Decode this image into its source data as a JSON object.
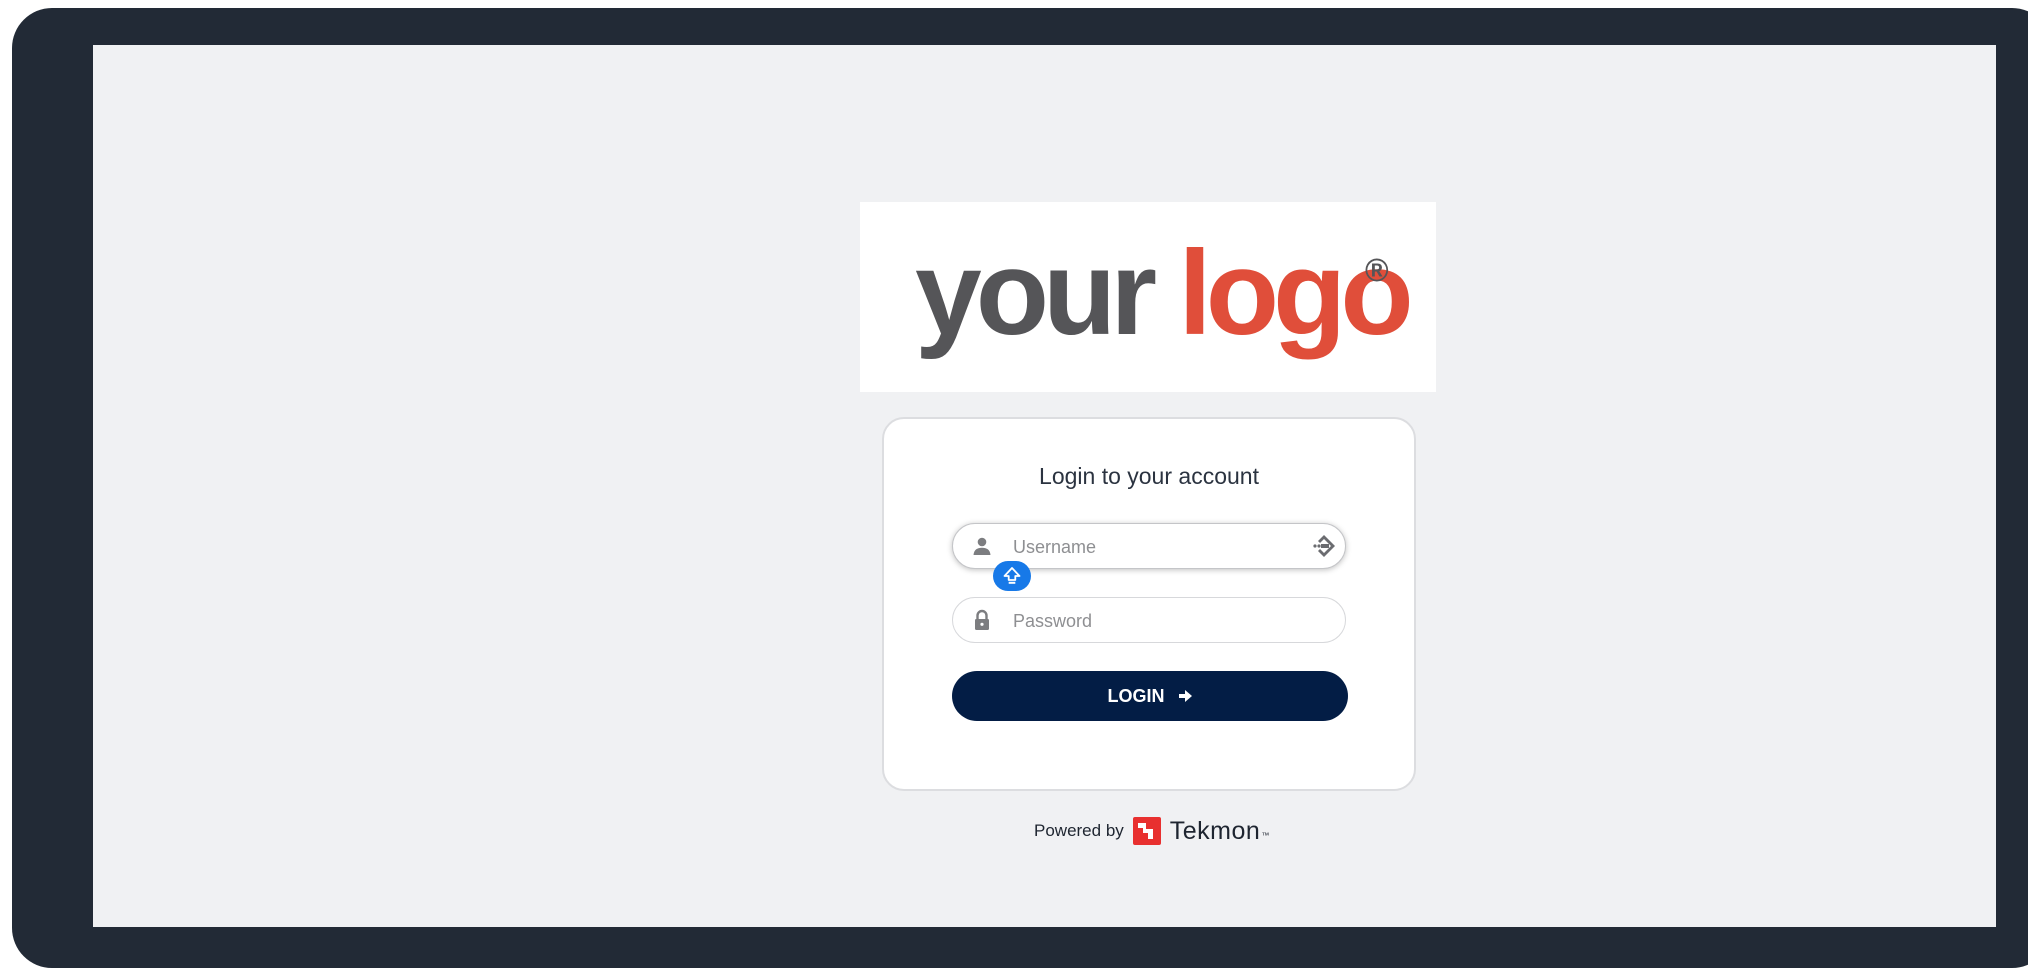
{
  "brand_logo": {
    "word1": "your",
    "word2": "logo",
    "registered": "®",
    "colors": {
      "word1": "#555558",
      "word2": "#e04e3a"
    }
  },
  "login_card": {
    "title": "Login to your account",
    "username": {
      "placeholder": "Username",
      "value": "",
      "icon": "user-icon",
      "trailing_icon": "password-manager-icon"
    },
    "caps_lock_indicator": {
      "icon": "caps-lock-icon"
    },
    "password": {
      "placeholder": "Password",
      "value": "",
      "icon": "lock-icon"
    },
    "login_button": {
      "label": "LOGIN",
      "icon": "arrow-right-icon",
      "color": "#031d45"
    }
  },
  "footer": {
    "powered_by_label": "Powered by",
    "vendor_name": "Tekmon",
    "vendor_mark": "™",
    "vendor_logo_color": "#e8302f"
  },
  "theme": {
    "frame": "#222a36",
    "background": "#f0f1f3",
    "accent_blue": "#1779e8"
  }
}
